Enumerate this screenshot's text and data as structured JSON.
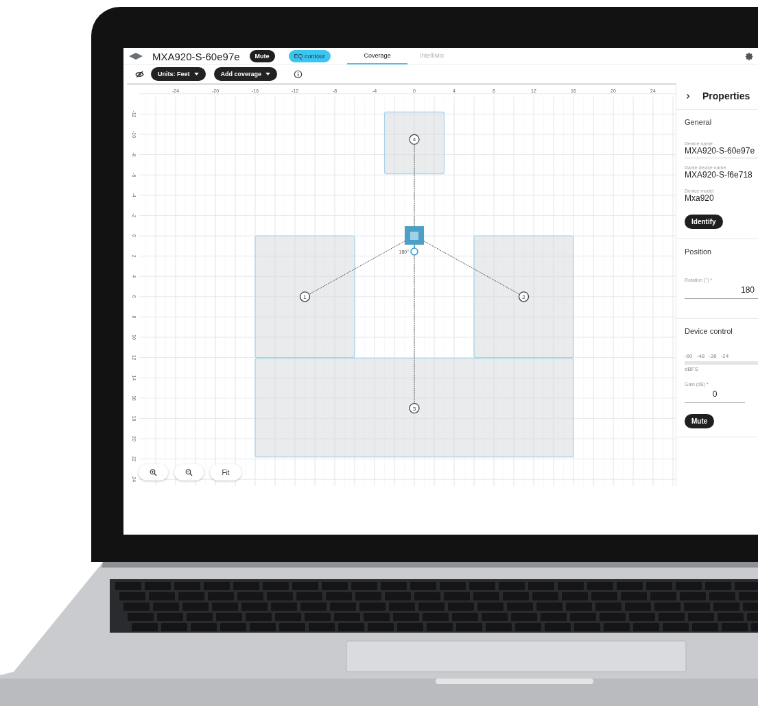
{
  "header": {
    "title": "MXA920-S-60e97e",
    "toggles": [
      {
        "label": "Mute",
        "on": false
      },
      {
        "label": "EQ contour",
        "on": true
      }
    ],
    "tabs": [
      {
        "label": "Coverage",
        "selected": true
      },
      {
        "label": "IntelliMix",
        "selected": false
      }
    ]
  },
  "toolbar": {
    "menus": [
      "Units: Feet",
      "Add coverage"
    ]
  },
  "canvas": {
    "x_ticks": [
      "-24",
      "-20",
      "-16",
      "-12",
      "-8",
      "-4",
      "0",
      "4",
      "8",
      "12",
      "16",
      "20",
      "24"
    ],
    "y_ticks": [
      "-12",
      "-10",
      "-8",
      "-6",
      "-4",
      "-2",
      "0",
      "2",
      "4",
      "6",
      "8",
      "10",
      "12",
      "14",
      "16",
      "18",
      "20",
      "22",
      "24"
    ],
    "coverage_areas": [
      {
        "label": "4"
      },
      {
        "label": "1"
      },
      {
        "label": "2"
      },
      {
        "label": "3"
      }
    ],
    "device": {
      "angle": "180°"
    },
    "fit_button": "Fit"
  },
  "properties": {
    "title": "Properties",
    "general": {
      "heading": "General",
      "fields": [
        {
          "label": "Device name",
          "value": "MXA920-S-60e97e",
          "kind": "input"
        },
        {
          "label": "Dante device name",
          "value": "MXA920-S-f6e718",
          "kind": "text"
        },
        {
          "label": "Device model",
          "value": "Mxa920",
          "kind": "text"
        }
      ],
      "button": "Identify"
    },
    "position": {
      "heading": "Position",
      "rotation": {
        "label": "Rotation (°) *",
        "value": "180"
      }
    },
    "device_control": {
      "heading": "Device control",
      "meter": {
        "scale": [
          "-60",
          "-48",
          "-36",
          "-24"
        ],
        "unit": "dBFS"
      },
      "gain": {
        "label": "Gain (dB) *",
        "value": "0"
      },
      "button": "Mute"
    }
  }
}
